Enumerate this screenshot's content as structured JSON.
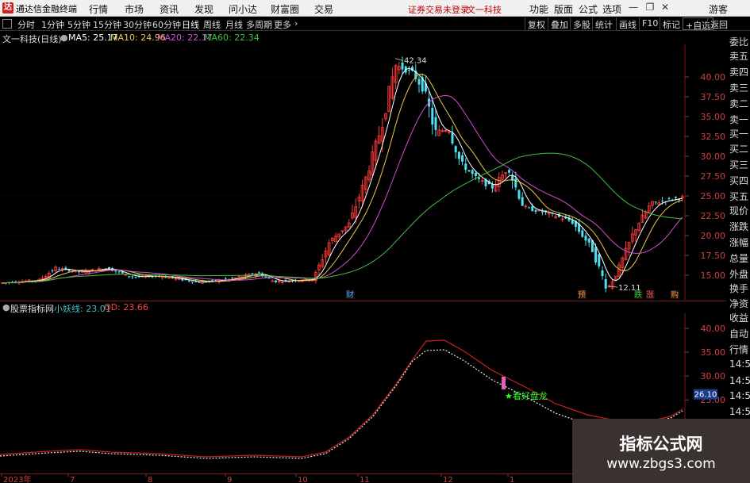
{
  "menubar": {
    "logo_glyph": "达",
    "title": "通达信金融终端",
    "items": [
      "行情",
      "市场",
      "资讯",
      "发现",
      "问小达",
      "财富圈",
      "交易"
    ],
    "notice": "证券交易未登录",
    "stock_name": "文一科技",
    "right_items": [
      "功能",
      "版面",
      "公式",
      "选项"
    ],
    "guest": "游客",
    "window_controls": [
      "—",
      "❐",
      "✕"
    ]
  },
  "periodbar": {
    "periods": [
      "分时",
      "1分钟",
      "5分钟",
      "15分钟",
      "30分钟",
      "60分钟",
      "日线",
      "周线",
      "月线",
      "多周期",
      "更多"
    ],
    "active_period": "日线",
    "tools": [
      "复权",
      "叠加",
      "多股",
      "统计",
      "画线",
      "F10",
      "标记",
      "+自选",
      "返回"
    ]
  },
  "main_chart": {
    "stock_label": "文一科技(日线)",
    "ma": [
      {
        "label": "MA5: 25.17",
        "color": "#ffffff"
      },
      {
        "label": "MA10: 24.96",
        "color": "#e8c84a"
      },
      {
        "label": "MA20: 22.17",
        "color": "#d050d0"
      },
      {
        "label": "MA60: 22.34",
        "color": "#40c040"
      }
    ],
    "high_label": "42.34",
    "low_label": "12.11",
    "y_ticks": [
      "40.00",
      "37.50",
      "35.00",
      "32.50",
      "30.00",
      "27.50",
      "25.00",
      "22.50",
      "20.00",
      "17.50",
      "15.00"
    ],
    "event_markers": [
      {
        "text": "财",
        "color": "#5a9bff"
      },
      {
        "text": "预",
        "color": "#ff8c3a"
      },
      {
        "text": "跌",
        "color": "#30d030"
      },
      {
        "text": "涨",
        "color": "#ff5050"
      },
      {
        "text": "购",
        "color": "#ff8c3a"
      }
    ]
  },
  "indicator": {
    "name": "股票指标网",
    "line_label": "小妖线: 23.01",
    "line_color": "#40c0c0",
    "qd_label": "QD: 23.66",
    "qd_color": "#ff4040",
    "y_ticks": [
      "40.00",
      "35.00",
      "30.00",
      "25.00"
    ],
    "current_value": "26.10",
    "signal_text": "★看好盘龙"
  },
  "x_axis": {
    "labels": [
      "2023年",
      "7",
      "8",
      "9",
      "10",
      "11",
      "12",
      "1"
    ]
  },
  "sidelist": {
    "items": [
      "委比",
      "卖五",
      "卖四",
      "卖三",
      "卖二",
      "卖一",
      "买一",
      "买二",
      "买三",
      "买四",
      "买五",
      "现价",
      "涨跌",
      "涨幅",
      "总量",
      "外盘",
      "换手",
      "净资",
      "收益",
      "自动",
      "行情",
      "14:50",
      "14:50",
      "14:50",
      "14:50",
      "14:50",
      "14:50",
      "14:50",
      "14:50"
    ]
  },
  "watermark": {
    "title": "指标公式网",
    "url": "www.zbgs3.com"
  },
  "chart_data": {
    "type": "candlestick",
    "price_range": [
      12.5,
      43.5
    ],
    "indicator_range": [
      22.5,
      42.5
    ],
    "highlighted_points": {
      "high": 42.34,
      "low": 12.11
    }
  }
}
